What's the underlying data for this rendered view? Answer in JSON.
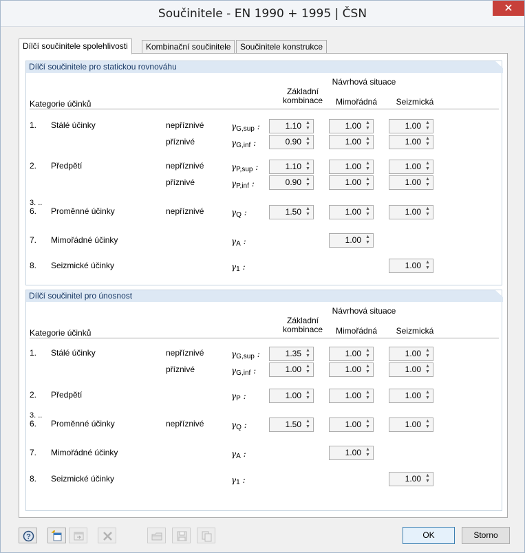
{
  "window": {
    "title": "Součinitele - EN 1990 + 1995 | ČSN",
    "close": "✕"
  },
  "tabs": [
    {
      "label": "Dílčí součinitele spolehlivosti",
      "active": true
    },
    {
      "label": "Kombinační součinitele",
      "active": false
    },
    {
      "label": "Součinitele konstrukce",
      "active": false
    }
  ],
  "headers": {
    "design_situation": "Návrhová situace",
    "basic": "Základní\nkombinace",
    "accidental": "Mimořádná",
    "seismic": "Seizmická",
    "category": "Kategorie účinků"
  },
  "group1": {
    "title": "Dílčí součinitele pro statickou rovnováhu",
    "rows": {
      "r1_num": "1.",
      "r1_name": "Stálé účinky",
      "r1_unfav": "nepříznivé",
      "r1_fav": "příznivé",
      "r1_g1": "γ",
      "r1_g1s": "G,sup",
      "r1_g2": "γ",
      "r1_g2s": "G,inf",
      "r2_num": "2.",
      "r2_name": "Předpětí",
      "r2_unfav": "nepříznivé",
      "r2_fav": "příznivé",
      "r2_g1": "γ",
      "r2_g1s": "P,sup",
      "r2_g2": "γ",
      "r2_g2s": "P,inf",
      "r3_num_a": "3. ..",
      "r3_num_b": "6.",
      "r3_name": "Proměnné účinky",
      "r3_unfav": "nepříznivé",
      "r3_g": "γ",
      "r3_gs": "Q",
      "r4_num": "7.",
      "r4_name": "Mimořádné účinky",
      "r4_g": "γ",
      "r4_gs": "A",
      "r5_num": "8.",
      "r5_name": "Seizmické účinky",
      "r5_g": "γ",
      "r5_gs": "1"
    },
    "values": {
      "g_sup": [
        "1.10",
        "1.00",
        "1.00"
      ],
      "g_inf": [
        "0.90",
        "1.00",
        "1.00"
      ],
      "p_sup": [
        "1.10",
        "1.00",
        "1.00"
      ],
      "p_inf": [
        "0.90",
        "1.00",
        "1.00"
      ],
      "q": [
        "1.50",
        "1.00",
        "1.00"
      ],
      "a": "1.00",
      "e": "1.00"
    }
  },
  "group2": {
    "title": "Dílčí součinitel pro únosnost",
    "rows": {
      "r1_num": "1.",
      "r1_name": "Stálé účinky",
      "r1_unfav": "nepříznivé",
      "r1_fav": "příznivé",
      "r1_g1": "γ",
      "r1_g1s": "G,sup",
      "r1_g2": "γ",
      "r1_g2s": "G,inf",
      "r2_num": "2.",
      "r2_name": "Předpětí",
      "r2_g": "γ",
      "r2_gs": "P",
      "r3_num_a": "3. ..",
      "r3_num_b": "6.",
      "r3_name": "Proměnné účinky",
      "r3_unfav": "nepříznivé",
      "r3_g": "γ",
      "r3_gs": "Q",
      "r4_num": "7.",
      "r4_name": "Mimořádné účinky",
      "r4_g": "γ",
      "r4_gs": "A",
      "r5_num": "8.",
      "r5_name": "Seizmické účinky",
      "r5_g": "γ",
      "r5_gs": "1"
    },
    "values": {
      "g_sup": [
        "1.35",
        "1.00",
        "1.00"
      ],
      "g_inf": [
        "1.00",
        "1.00",
        "1.00"
      ],
      "p": [
        "1.00",
        "1.00",
        "1.00"
      ],
      "q": [
        "1.50",
        "1.00",
        "1.00"
      ],
      "a": "1.00",
      "e": "1.00"
    }
  },
  "colon": ":",
  "buttons": {
    "ok": "OK",
    "cancel": "Storno"
  },
  "footer_icons": [
    "help-icon",
    "new-icon",
    "import-icon",
    "delete-icon",
    "load-icon",
    "save-icon",
    "copy-icon"
  ],
  "colors": {
    "accent": "#3c7fb1",
    "close": "#c7403a",
    "group_header": "#dde8f4"
  }
}
